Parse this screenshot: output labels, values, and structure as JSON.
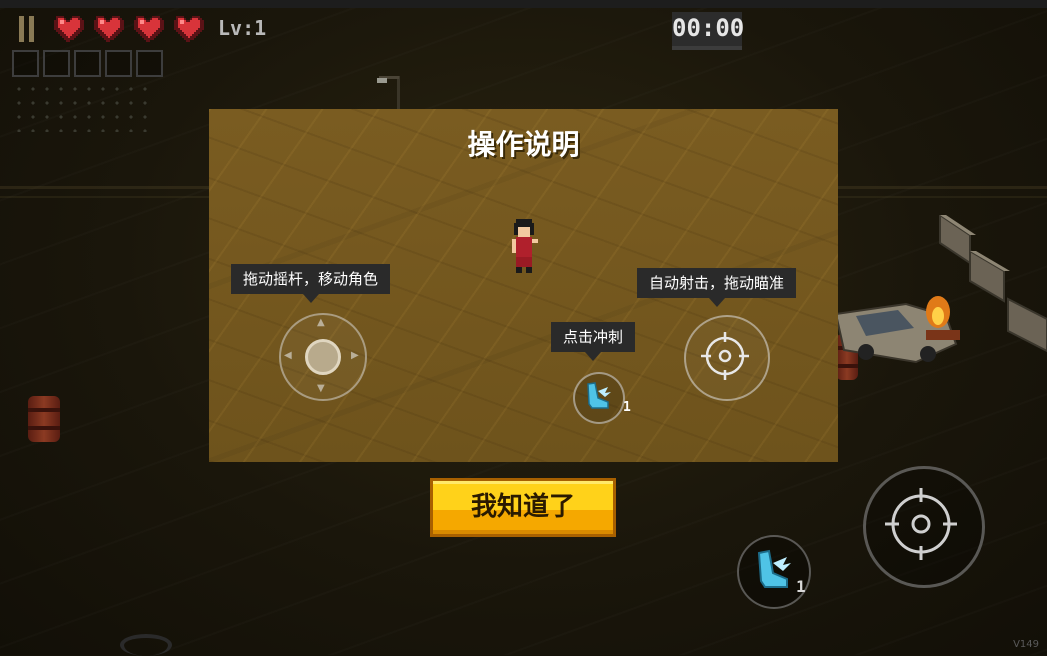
{
  "hud": {
    "level": "Lv:1",
    "timer": "00:00",
    "hearts": 4,
    "slots": 5
  },
  "dialog": {
    "title": "操作说明",
    "tips": {
      "move": "拖动摇杆，移动角色",
      "shoot": "自动射击，拖动瞄准",
      "dash": "点击冲刺"
    },
    "dash_count": "1"
  },
  "confirm_label": "我知道了",
  "controls": {
    "dash_count": "1"
  },
  "version": "V149",
  "colors": {
    "heart": "#d8343a",
    "dialog_bg": "#7a5c21",
    "button": "#ffd21a",
    "tip_bg": "#2a2a2a",
    "dash_icon": "#4fc3e6"
  },
  "icons": [
    "pause-icon",
    "heart-icon",
    "crosshair-icon",
    "winged-boot-icon",
    "joystick-icon"
  ]
}
